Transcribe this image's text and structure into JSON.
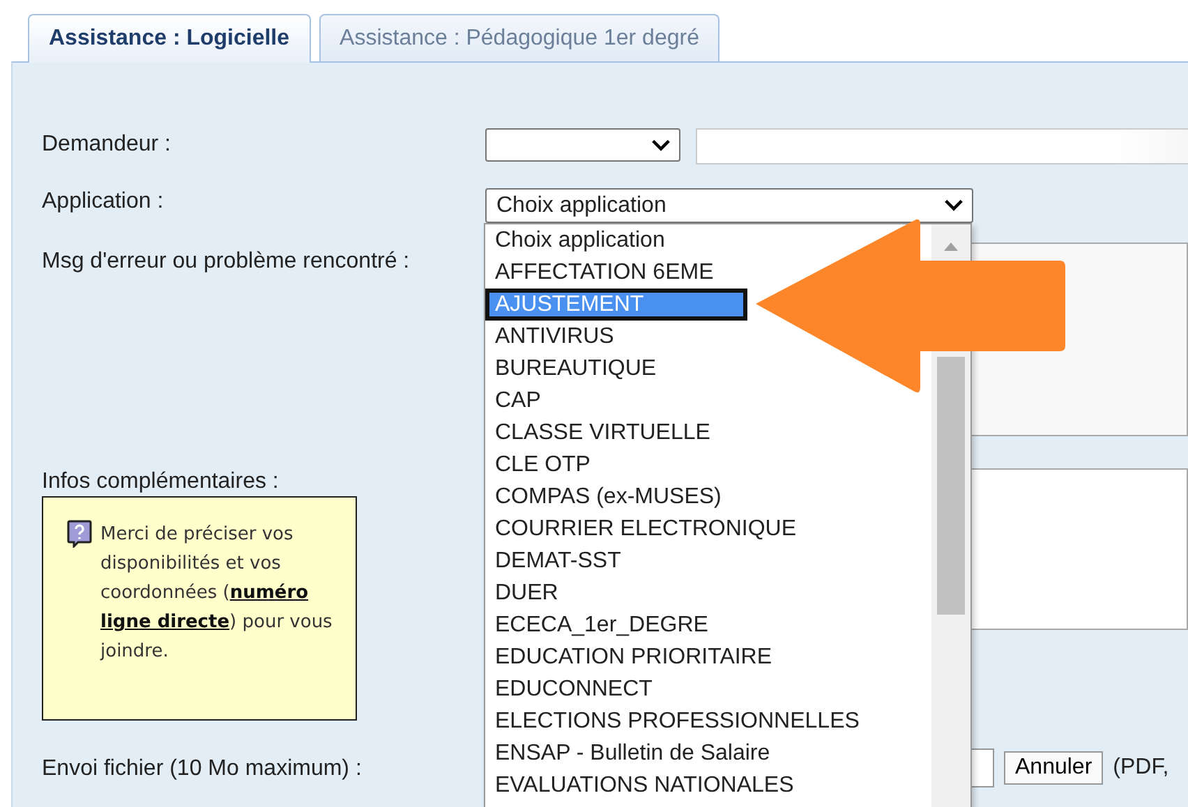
{
  "tabs": [
    {
      "label": "Assistance : Logicielle",
      "selected": true
    },
    {
      "label": "Assistance : Pédagogique 1er degré",
      "selected": false
    }
  ],
  "form": {
    "demandeur": {
      "label": "Demandeur :"
    },
    "application": {
      "label": "Application :",
      "value": "Choix application",
      "expanded": true,
      "options": [
        {
          "label": "Choix application",
          "highlighted": false
        },
        {
          "label": "AFFECTATION 6EME",
          "highlighted": false
        },
        {
          "label": "AJUSTEMENT",
          "highlighted": true
        },
        {
          "label": "ANTIVIRUS",
          "highlighted": false
        },
        {
          "label": "BUREAUTIQUE",
          "highlighted": false
        },
        {
          "label": "CAP",
          "highlighted": false
        },
        {
          "label": "CLASSE VIRTUELLE",
          "highlighted": false
        },
        {
          "label": "CLE OTP",
          "highlighted": false
        },
        {
          "label": "COMPAS (ex-MUSES)",
          "highlighted": false
        },
        {
          "label": "COURRIER ELECTRONIQUE",
          "highlighted": false
        },
        {
          "label": "DEMAT-SST",
          "highlighted": false
        },
        {
          "label": "DUER",
          "highlighted": false
        },
        {
          "label": "ECECA_1er_DEGRE",
          "highlighted": false
        },
        {
          "label": "EDUCATION PRIORITAIRE",
          "highlighted": false
        },
        {
          "label": "EDUCONNECT",
          "highlighted": false
        },
        {
          "label": "ELECTIONS PROFESSIONNELLES",
          "highlighted": false
        },
        {
          "label": "ENSAP - Bulletin de Salaire",
          "highlighted": false
        },
        {
          "label": "EVALUATIONS NATIONALES",
          "highlighted": false
        }
      ]
    },
    "message": {
      "label": "Msg d'erreur ou problème rencontré :"
    },
    "infos": {
      "label": "Infos complémentaires :",
      "note": "Merci de préciser vos disponibilités et vos coordonnées (**numéro ligne directe**) pour vous joindre."
    },
    "file": {
      "label": "Envoi fichier (10 Mo maximum) :",
      "cancel_button": "Annuler",
      "formats": "(PDF,"
    }
  }
}
